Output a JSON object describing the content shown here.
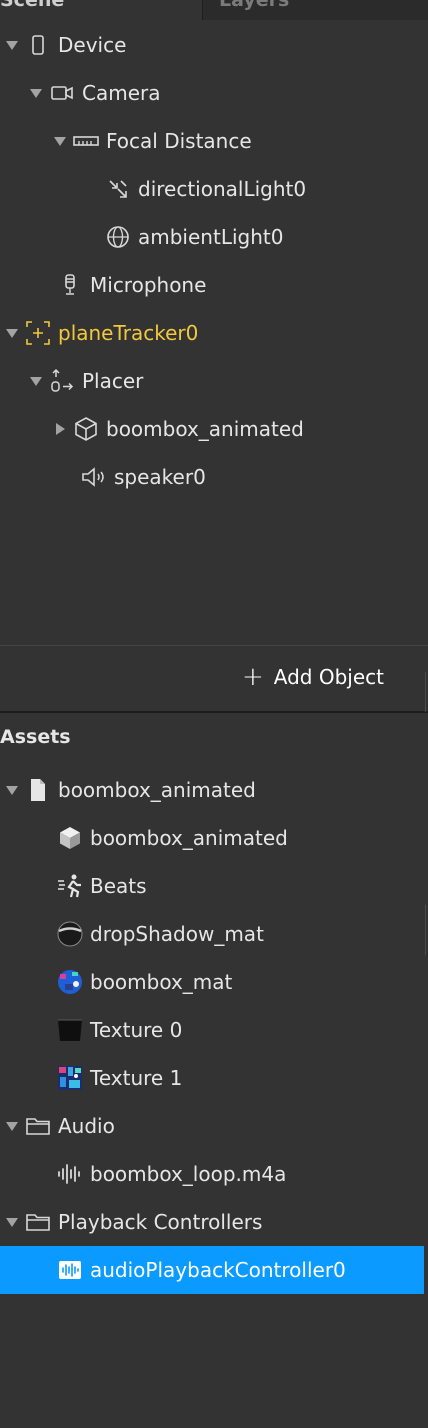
{
  "tabs": {
    "scene": "Scene",
    "layers": "Layers"
  },
  "scene_tree": [
    {
      "label": "Device",
      "icon": "phone-icon",
      "arrow": "down"
    },
    {
      "label": "Camera",
      "icon": "camera-icon",
      "arrow": "down"
    },
    {
      "label": "Focal Distance",
      "icon": "ruler-icon",
      "arrow": "down"
    },
    {
      "label": "directionalLight0",
      "icon": "directional-light-icon",
      "arrow": "none"
    },
    {
      "label": "ambientLight0",
      "icon": "globe-icon",
      "arrow": "none"
    },
    {
      "label": "Microphone",
      "icon": "microphone-icon",
      "arrow": "none"
    },
    {
      "label": "planeTracker0",
      "icon": "plane-tracker-icon",
      "arrow": "down",
      "active": true
    },
    {
      "label": "Placer",
      "icon": "placer-icon",
      "arrow": "down"
    },
    {
      "label": "boombox_animated",
      "icon": "cube-outline-icon",
      "arrow": "right"
    },
    {
      "label": "speaker0",
      "icon": "speaker-icon",
      "arrow": "none"
    }
  ],
  "add_object": {
    "label": "Add Object"
  },
  "assets": {
    "title": "Assets",
    "items": [
      {
        "label": "boombox_animated",
        "icon": "file-icon",
        "arrow": "down"
      },
      {
        "label": "boombox_animated",
        "icon": "cube-solid-icon",
        "arrow": "none"
      },
      {
        "label": "Beats",
        "icon": "animation-icon",
        "arrow": "none"
      },
      {
        "label": "dropShadow_mat",
        "icon": "material-sphere-dark-icon",
        "arrow": "none"
      },
      {
        "label": "boombox_mat",
        "icon": "material-sphere-color-icon",
        "arrow": "none"
      },
      {
        "label": "Texture 0",
        "icon": "texture-dark-icon",
        "arrow": "none"
      },
      {
        "label": "Texture 1",
        "icon": "texture-color-icon",
        "arrow": "none"
      },
      {
        "label": "Audio",
        "icon": "folder-icon",
        "arrow": "down"
      },
      {
        "label": "boombox_loop.m4a",
        "icon": "waveform-icon",
        "arrow": "none"
      },
      {
        "label": "Playback Controllers",
        "icon": "folder-icon",
        "arrow": "down"
      },
      {
        "label": "audioPlaybackController0",
        "icon": "audio-controller-icon",
        "arrow": "none",
        "selected": true
      }
    ]
  },
  "colors": {
    "background": "#333333",
    "selection": "#0b9aff",
    "active_text": "#f2c83c"
  }
}
